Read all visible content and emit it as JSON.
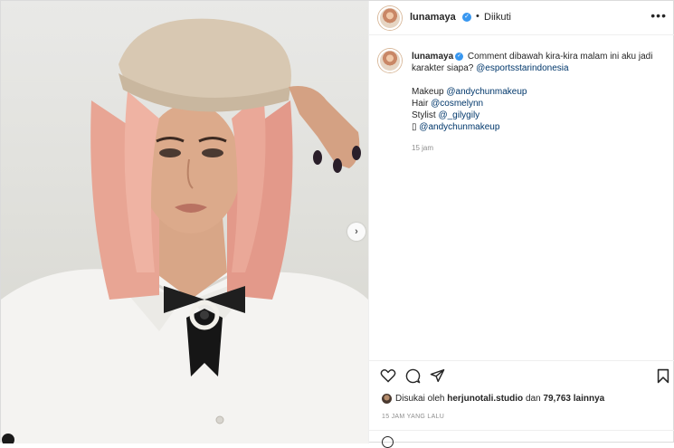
{
  "post": {
    "header": {
      "username": "lunamaya",
      "separator": "•",
      "follow_status": "Diikuti",
      "more_icon": "more-horizontal-icon"
    },
    "caption": {
      "username": "lunamaya",
      "text": "Comment dibawah kira-kira malam ini aku jadi karakter siapa?",
      "tag_main": "@esportsstarindonesia",
      "credits": [
        {
          "label": "Makeup",
          "tag": "@andychunmakeup"
        },
        {
          "label": "Hair",
          "tag": "@cosmelynn"
        },
        {
          "label": "Stylist",
          "tag": "@_gilygily"
        },
        {
          "label": "",
          "tag": "@andychunmakeup"
        }
      ],
      "time": "15 jam"
    },
    "actions": {
      "icons": [
        "heart-icon",
        "comment-icon",
        "share-icon",
        "bookmark-icon"
      ]
    },
    "likes": {
      "prefix": "Disukai oleh",
      "user": "herjunotali.studio",
      "middle": "dan",
      "count": "79,763",
      "suffix": "lainnya"
    },
    "timestamp": "15 JAM YANG LALU",
    "carousel_next": "›"
  },
  "colors": {
    "tag": "#00376b",
    "verified": "#3897f0",
    "muted": "#8e8e8e",
    "text": "#262626"
  }
}
